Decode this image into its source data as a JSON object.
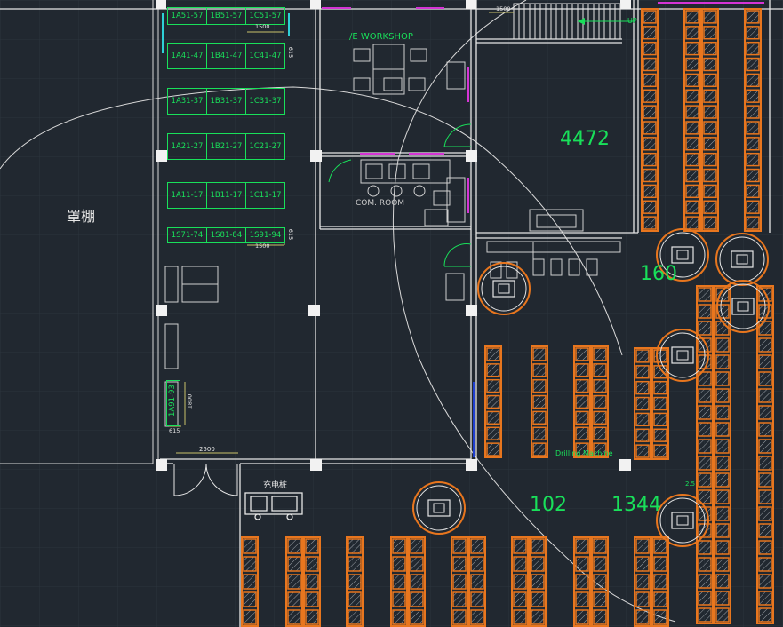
{
  "labels": {
    "canopy": "罩棚",
    "workshop": "I/E WORKSHOP",
    "com_room": "COM. ROOM",
    "charging": "充电桩",
    "drilling": "Drilling Machine",
    "up": "UP",
    "n4472": "4472",
    "n160": "160",
    "n102": "102",
    "n1344": "1344"
  },
  "dimensions": {
    "d1500a": "1500",
    "d1500b": "1500",
    "d1500c": "1500",
    "d615a": "615",
    "d615b": "615",
    "d615c": "615",
    "d1800": "1800",
    "d2500": "2500",
    "d25": "2.5"
  },
  "storage_bays": [
    [
      "1A51-57",
      "1B51-57",
      "1C51-57"
    ],
    [
      "1A41-47",
      "1B41-47",
      "1C41-47"
    ],
    [
      "1A31-37",
      "1B31-37",
      "1C31-37"
    ],
    [
      "1A21-27",
      "1B21-27",
      "1C21-27"
    ],
    [
      "1A11-17",
      "1B11-17",
      "1C11-17"
    ],
    [
      "1S71-74",
      "1S81-84",
      "1S91-94"
    ]
  ],
  "side_bay": "1A91-93",
  "colors": {
    "background": "#212830",
    "wall": "#e6e6e6",
    "label_green": "#19e05a",
    "rack_orange": "#e8761e",
    "door_green": "#19e05a",
    "magenta": "#d534d5",
    "cyan": "#2ed0d6",
    "dim_yellow": "#c9c26a"
  }
}
